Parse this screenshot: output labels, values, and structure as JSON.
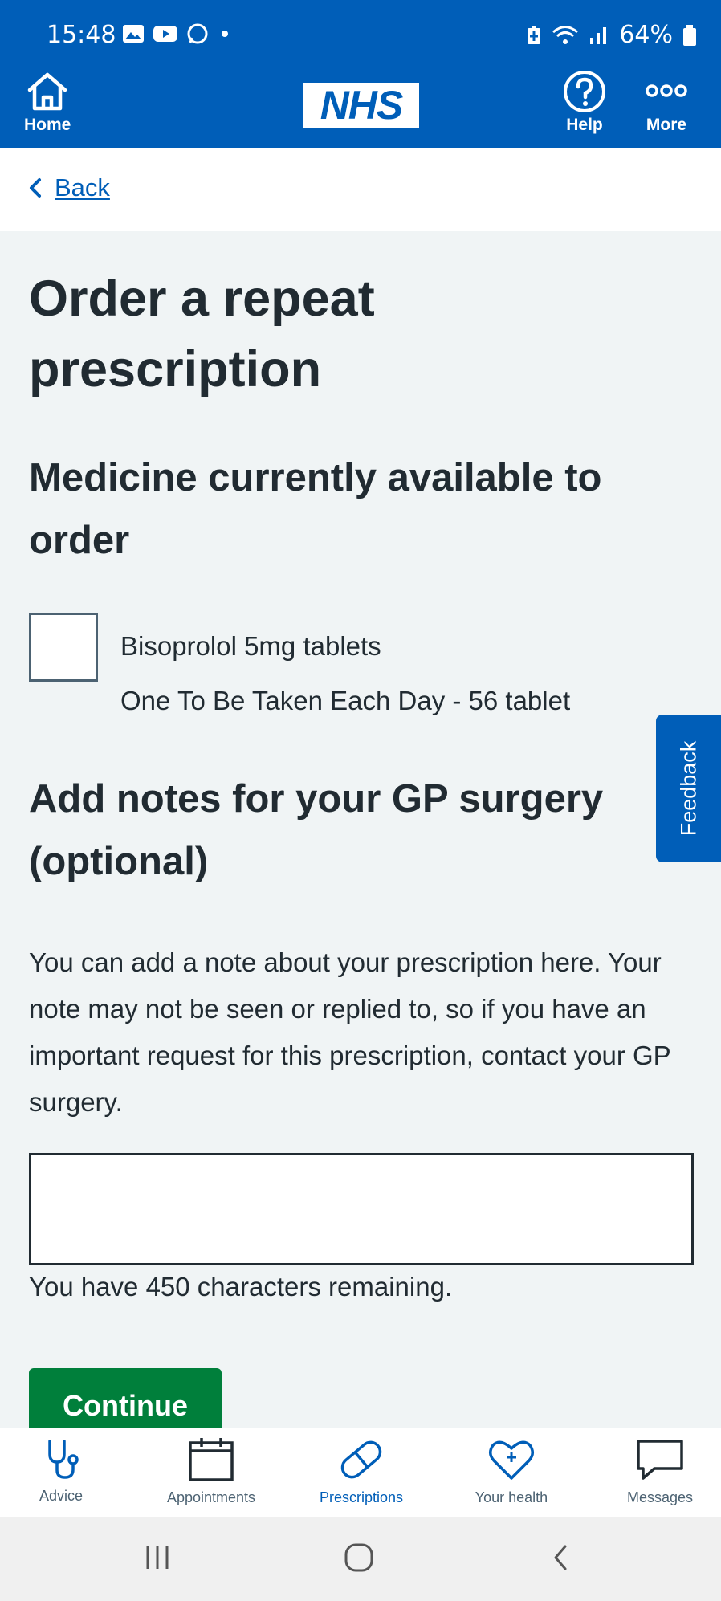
{
  "status_bar": {
    "time": "15:48",
    "battery": "64%"
  },
  "header": {
    "home_label": "Home",
    "logo_text": "NHS",
    "help_label": "Help",
    "more_label": "More",
    "brand_color": "#005eb8"
  },
  "back": {
    "label": "Back"
  },
  "page": {
    "title": "Order a repeat prescription",
    "medicine_section_title": "Medicine currently available to order",
    "medicine": {
      "name": "Bisoprolol 5mg tablets",
      "dosage": "One To Be Taken Each Day - 56 tablet",
      "checked": false
    },
    "notes_section_title": "Add notes for your GP surgery (optional)",
    "notes_description": "You can add a note about your prescription here. Your note may not be seen or replied to, so if you have an important request for this prescription, contact your GP surgery.",
    "notes_value": "",
    "characters_remaining": "You have 450 characters remaining.",
    "continue_label": "Continue",
    "continue_color": "#007f3b"
  },
  "feedback": {
    "label": "Feedback"
  },
  "bottom_nav": {
    "items": [
      {
        "label": "Advice",
        "icon": "stethoscope-icon",
        "active": false
      },
      {
        "label": "Appointments",
        "icon": "calendar-icon",
        "active": false
      },
      {
        "label": "Prescriptions",
        "icon": "pill-icon",
        "active": true
      },
      {
        "label": "Your health",
        "icon": "heart-icon",
        "active": false
      },
      {
        "label": "Messages",
        "icon": "speech-bubble-icon",
        "active": false
      }
    ]
  }
}
